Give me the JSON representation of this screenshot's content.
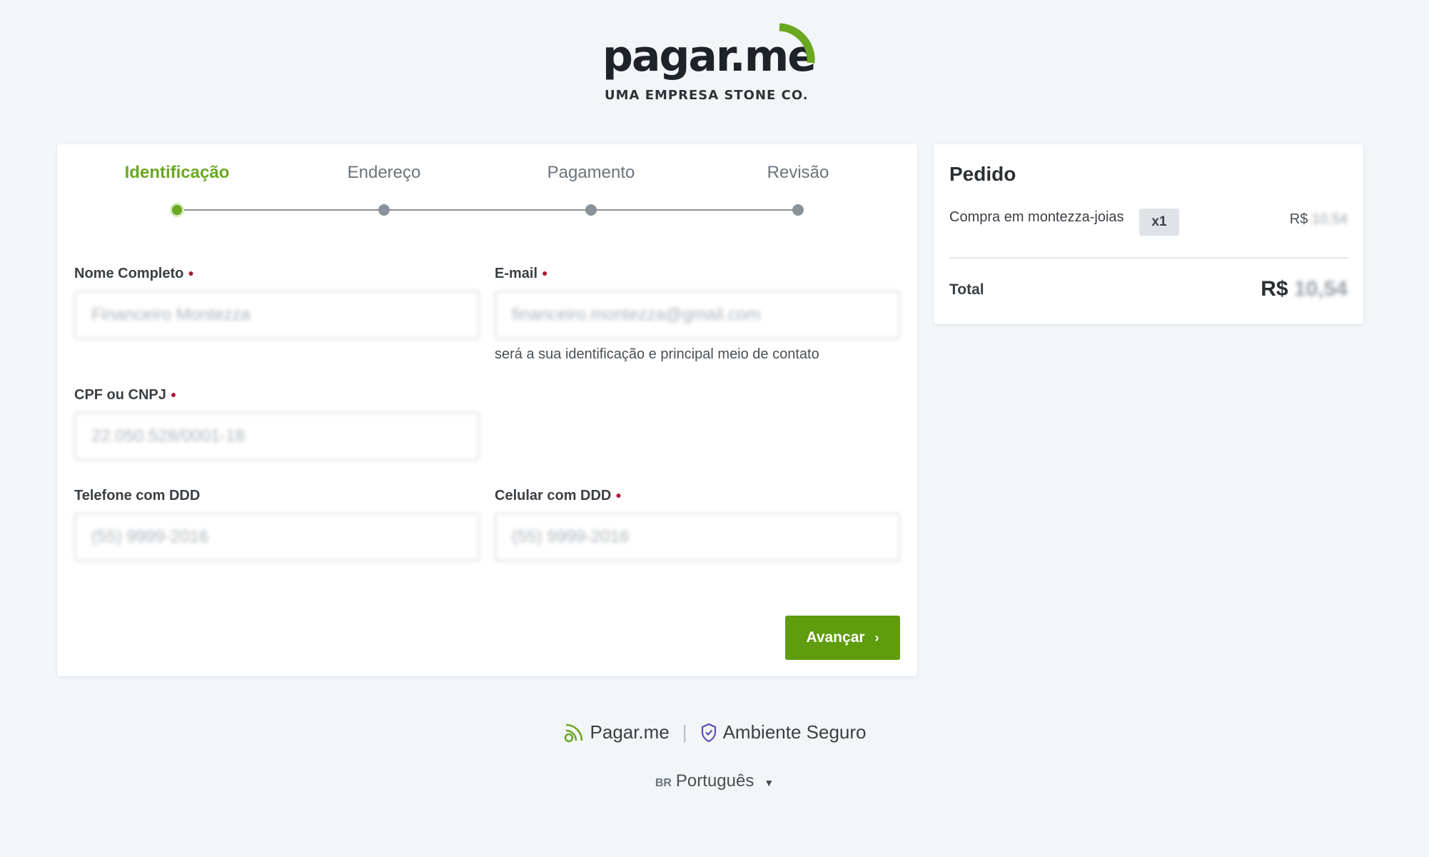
{
  "brand": {
    "name": "pagar.me",
    "tagline": "UMA EMPRESA STONE CO.",
    "accent_color": "#6aa820",
    "button_color": "#5f9c0e"
  },
  "steps": [
    {
      "label": "Identificação",
      "active": true
    },
    {
      "label": "Endereço",
      "active": false
    },
    {
      "label": "Pagamento",
      "active": false
    },
    {
      "label": "Revisão",
      "active": false
    }
  ],
  "form": {
    "full_name": {
      "label": "Nome Completo",
      "value": "Financeiro Montezza",
      "required": true
    },
    "email": {
      "label": "E-mail",
      "value": "financeiro.montezza@gmail.com",
      "hint": "será a sua identificação e principal meio de contato",
      "required": true
    },
    "document": {
      "label": "CPF ou CNPJ",
      "value": "22.050.528/0001-18",
      "required": true
    },
    "phone": {
      "label": "Telefone com DDD",
      "value": "(55) 9999-2016",
      "required": false
    },
    "mobile": {
      "label": "Celular com DDD",
      "value": "(55) 9999-2016",
      "required": true
    },
    "required_marker": "●",
    "next_button": "Avançar",
    "next_chevron": "›"
  },
  "order": {
    "title": "Pedido",
    "item_name": "Compra em montezza-joias",
    "quantity": "x1",
    "item_price_prefix": "R$",
    "item_price": "10,54",
    "total_label": "Total",
    "total_price_prefix": "R$",
    "total_price": "10,54"
  },
  "footer": {
    "brand_link": "Pagar.me",
    "separator": "|",
    "secure_label": "Ambiente Seguro",
    "language_code": "BR",
    "language": "Português",
    "language_caret": "▼"
  }
}
